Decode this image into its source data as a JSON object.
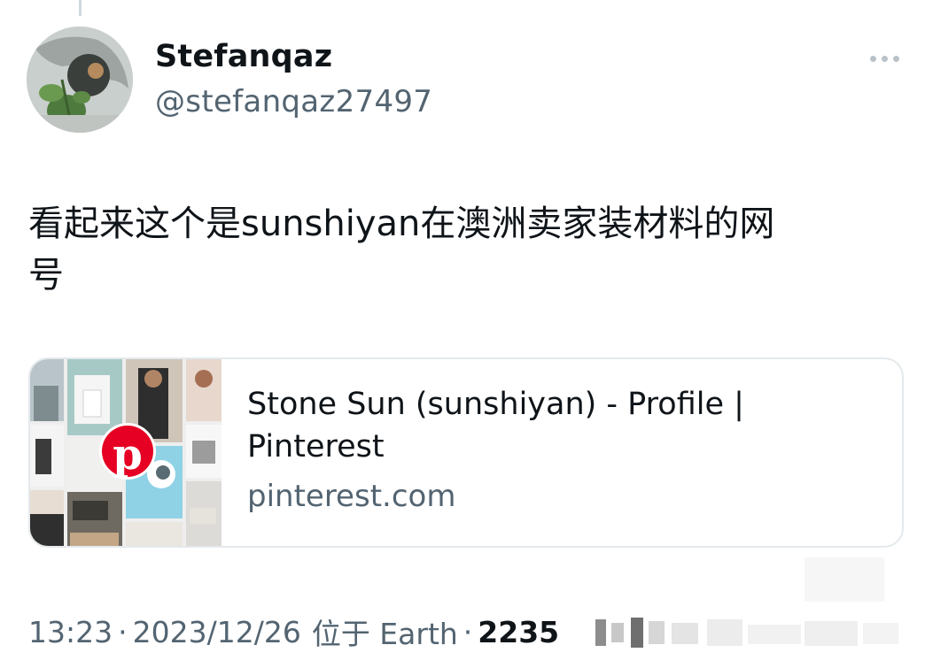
{
  "author": {
    "display_name": "Stefanqaz",
    "handle": "@stefanqaz27497"
  },
  "tweet": {
    "text_line1": "看起来这个是sunshiyan在澳洲卖家装材料的网",
    "text_line2": "号"
  },
  "link_card": {
    "title_line1": "Stone Sun (sunshiyan) - Profile |",
    "title_line2": "Pinterest",
    "domain": "pinterest.com",
    "thumbnail_icon": "pinterest-logo-icon"
  },
  "meta": {
    "time": "13:23",
    "separator": "·",
    "date": "2023/12/26",
    "location": "位于 Earth",
    "views": "2235"
  },
  "colors": {
    "text_primary": "#0f1419",
    "text_secondary": "#536471",
    "border": "#e4e9ec",
    "pinterest_red": "#e60023"
  },
  "icons": {
    "more": "more-horizontal-icon"
  }
}
